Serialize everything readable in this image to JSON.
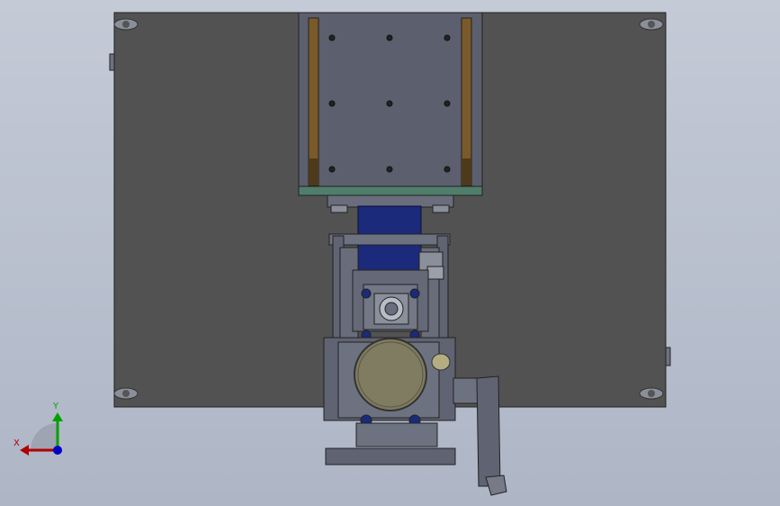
{
  "viewport": {
    "background_top": "#c4cad6",
    "background_bottom": "#aeb6c6"
  },
  "model": {
    "base_plate_color": "#525252",
    "carriage_color": "#5b5f6e",
    "rail_color": "#7a5a2a",
    "motor_color": "#1b2a7a",
    "bar_color": "#4f7e6a",
    "lens_color": "#7e7a60"
  },
  "triad": {
    "x_label": "X",
    "y_label": "Y",
    "x_color": "#b00000",
    "y_color": "#00a000",
    "z_color": "#0000c0"
  }
}
